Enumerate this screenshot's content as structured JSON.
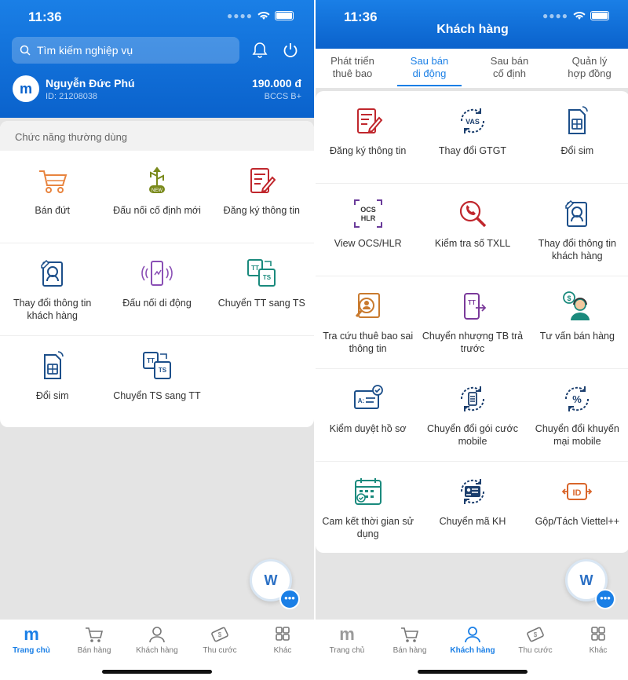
{
  "status": {
    "time": "11:36"
  },
  "home": {
    "search_placeholder": "Tìm kiếm nghiệp vụ",
    "user": {
      "avatar": "m",
      "name": "Nguyễn Đức Phú",
      "id": "ID: 21208038",
      "balance": "190.000 đ",
      "plan": "BCCS B+"
    },
    "section_title": "Chức năng thường dùng",
    "items": [
      {
        "label": "Bán đứt",
        "icon": "cart-icon"
      },
      {
        "label": "Đấu nối cố định mới",
        "icon": "usb-new-icon"
      },
      {
        "label": "Đăng ký thông tin",
        "icon": "notepad-pen-icon"
      },
      {
        "label": "Thay đổi thông tin khách hàng",
        "icon": "profile-edit-icon"
      },
      {
        "label": "Đấu nối di động",
        "icon": "phone-signal-icon"
      },
      {
        "label": "Chuyển TT sang TS",
        "icon": "tt-ts-icon"
      },
      {
        "label": "Đổi sim",
        "icon": "sim-icon"
      },
      {
        "label": "Chuyển TS sang TT",
        "icon": "ts-tt-icon"
      }
    ],
    "chat_label": "W",
    "nav": [
      {
        "label": "Trang chủ",
        "icon": "home-icon",
        "active": true
      },
      {
        "label": "Bán hàng",
        "icon": "cart-icon"
      },
      {
        "label": "Khách hàng",
        "icon": "person-icon"
      },
      {
        "label": "Thu cước",
        "icon": "money-icon"
      },
      {
        "label": "Khác",
        "icon": "grid-icon"
      }
    ]
  },
  "customer": {
    "title": "Khách hàng",
    "tabs": [
      {
        "label": "Phát triển thuê bao"
      },
      {
        "label": "Sau bán di động",
        "active": true
      },
      {
        "label": "Sau bán cố định"
      },
      {
        "label": "Quản lý hợp đồng"
      }
    ],
    "items": [
      {
        "label": "Đăng ký thông tin",
        "icon": "notepad-pen-icon"
      },
      {
        "label": "Thay đổi GTGT",
        "icon": "vas-icon",
        "text": "VAS"
      },
      {
        "label": "Đổi sim",
        "icon": "sim-icon"
      },
      {
        "label": "View OCS/HLR",
        "icon": "ocs-hlr-icon",
        "text": "OCS HLR"
      },
      {
        "label": "Kiểm tra số TXLL",
        "icon": "phone-search-icon"
      },
      {
        "label": "Thay đổi thông tin khách hàng",
        "icon": "profile-edit-icon"
      },
      {
        "label": "Tra cứu thuê bao sai thông tin",
        "icon": "profile-search-icon"
      },
      {
        "label": "Chuyển nhượng TB trả trước",
        "icon": "phone-transfer-icon"
      },
      {
        "label": "Tư vấn bán hàng",
        "icon": "consultant-icon"
      },
      {
        "label": "Kiểm duyệt hồ sơ",
        "icon": "card-check-icon"
      },
      {
        "label": "Chuyển đổi gói cước mobile",
        "icon": "package-switch-icon"
      },
      {
        "label": "Chuyển đổi khuyến mại mobile",
        "icon": "promo-switch-icon"
      },
      {
        "label": "Cam kết thời gian sử dụng",
        "icon": "calendar-check-icon"
      },
      {
        "label": "Chuyển mã KH",
        "icon": "id-switch-icon"
      },
      {
        "label": "Gộp/Tách Viettel++",
        "icon": "id-merge-icon",
        "text": "ID"
      }
    ],
    "chat_label": "W",
    "nav": [
      {
        "label": "Trang chủ",
        "icon": "home-icon"
      },
      {
        "label": "Bán hàng",
        "icon": "cart-icon"
      },
      {
        "label": "Khách hàng",
        "icon": "person-icon",
        "active": true
      },
      {
        "label": "Thu cước",
        "icon": "money-icon"
      },
      {
        "label": "Khác",
        "icon": "grid-icon"
      }
    ]
  }
}
